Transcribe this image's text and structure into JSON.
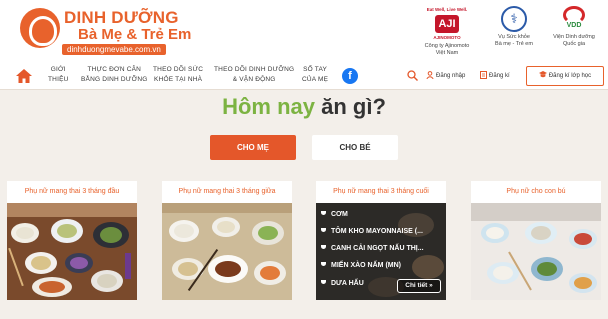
{
  "header": {
    "logo_line1": "DINH DƯỠNG",
    "logo_line2": "Bà Mẹ & Trẻ Em",
    "logo_url": "dinhduongmevabe.com.vn",
    "partners": [
      {
        "top": "Eat Well, Live Well.",
        "mark": "AJI",
        "word": "AJINOMOTO",
        "name_line1": "Công ty Ajinomoto",
        "name_line2": "Việt Nam"
      },
      {
        "mark": "⚕",
        "name_line1": "Vụ Sức khỏe",
        "name_line2": "Bà mẹ - Trẻ em"
      },
      {
        "mark": "VDD",
        "name_line1": "Viện Dinh dưỡng",
        "name_line2": "Quốc gia"
      }
    ]
  },
  "nav": {
    "items": [
      {
        "line1": "GIỚI",
        "line2": "THIỆU"
      },
      {
        "line1": "THỰC ĐƠN CÂN",
        "line2": "BẰNG DINH DƯỠNG"
      },
      {
        "line1": "THEO DÕI SỨC",
        "line2": "KHỎE TẠI NHÀ"
      },
      {
        "line1": "THEO DÕI DINH DƯỠNG",
        "line2": "& VẬN ĐỘNG"
      },
      {
        "line1": "SỔ TAY",
        "line2": "CỦA MẸ"
      }
    ],
    "login": "Đăng nhập",
    "register": "Đăng kí",
    "register_class": "Đăng kí lớp học"
  },
  "main": {
    "headline_green": "Hôm nay",
    "headline_dark": "ăn gì?",
    "tabs": [
      "CHO MẸ",
      "CHO BÉ"
    ],
    "cards": [
      {
        "title": "Phụ nữ mang thai 3 tháng đầu"
      },
      {
        "title": "Phụ nữ mang thai 3 tháng giữa"
      },
      {
        "title": "Phụ nữ mang thai 3 tháng cuối",
        "menu": [
          "CƠM",
          "TÔM KHO MAYONNAISE (...",
          "CANH CẢI NGỌT NẤU THỊ...",
          "MIẾN XÀO NẤM (MN)",
          "DƯA HẤU"
        ],
        "detail": "Chi tiết"
      },
      {
        "title": "Phụ nữ cho con bú"
      }
    ]
  },
  "colors": {
    "brand_orange": "#e8622c",
    "active_tab": "#e4572a",
    "headline_green": "#7cb342",
    "background": "#f3efea"
  }
}
